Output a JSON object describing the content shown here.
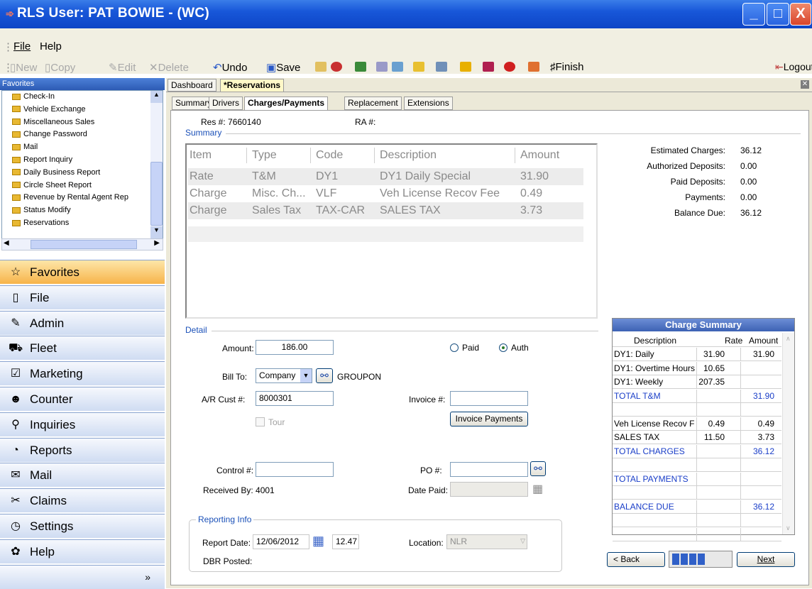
{
  "window": {
    "title": "RLS  User: PAT BOWIE - (WC)",
    "minimize": "_",
    "maximize": "□",
    "close": "X"
  },
  "menu": {
    "file": "File",
    "help": "Help"
  },
  "toolbar": {
    "new": "New",
    "copy": "Copy",
    "edit": "Edit",
    "delete": "Delete",
    "undo": "Undo",
    "save": "Save",
    "finish": "Finish",
    "logout": "Logout"
  },
  "favorites": {
    "header": "Favorites",
    "items": [
      "Check-In",
      "Vehicle Exchange",
      "Miscellaneous Sales",
      "Change Password",
      "Mail",
      "Report Inquiry",
      "Daily Business Report",
      "Circle Sheet Report",
      "Revenue by Rental Agent Rep",
      "Status Modify",
      "Reservations"
    ]
  },
  "nav": {
    "items": [
      {
        "label": "Favorites",
        "icon": "star-icon",
        "glyph": "☆"
      },
      {
        "label": "File",
        "icon": "document-icon",
        "glyph": "▯"
      },
      {
        "label": "Admin",
        "icon": "admin-tools-icon",
        "glyph": "✎"
      },
      {
        "label": "Fleet",
        "icon": "car-icon",
        "glyph": "⛟"
      },
      {
        "label": "Marketing",
        "icon": "checklist-icon",
        "glyph": "☑"
      },
      {
        "label": "Counter",
        "icon": "people-icon",
        "glyph": "☻"
      },
      {
        "label": "Inquiries",
        "icon": "magnifier-icon",
        "glyph": "⚲"
      },
      {
        "label": "Reports",
        "icon": "pie-chart-icon",
        "glyph": "◔"
      },
      {
        "label": "Mail",
        "icon": "envelope-icon",
        "glyph": "✉"
      },
      {
        "label": "Claims",
        "icon": "wrench-icon",
        "glyph": "✂"
      },
      {
        "label": "Settings",
        "icon": "clock-icon",
        "glyph": "◷"
      },
      {
        "label": "Help",
        "icon": "help-icon",
        "glyph": "✿"
      }
    ],
    "more": "»"
  },
  "doc_tabs": {
    "dashboard": "Dashboard",
    "reservations": "*Reservations"
  },
  "sub_tabs": [
    "Summary",
    "Drivers",
    "Charges/Payments",
    "Replacement",
    "Extensions"
  ],
  "res": {
    "res_label": "Res #:",
    "res_no": "7660140",
    "ra_label": "RA #:"
  },
  "summary": {
    "label": "Summary",
    "columns": [
      "Item",
      "Type",
      "Code",
      "Description",
      "Amount"
    ],
    "rows": [
      [
        "Rate",
        "T&M",
        "DY1",
        "DY1 Daily Special",
        "31.90"
      ],
      [
        "Charge",
        "Misc. Ch...",
        "VLF",
        "Veh License Recov Fee",
        "0.49"
      ],
      [
        "Charge",
        "Sales Tax",
        "TAX-CAR",
        "SALES TAX",
        "3.73"
      ]
    ]
  },
  "totals": [
    {
      "label": "Estimated Charges:",
      "value": "36.12"
    },
    {
      "label": "Authorized Deposits:",
      "value": "0.00"
    },
    {
      "label": "Paid Deposits:",
      "value": "0.00"
    },
    {
      "label": "Payments:",
      "value": "0.00"
    },
    {
      "label": "Balance Due:",
      "value": "36.12"
    }
  ],
  "detail": {
    "label": "Detail",
    "amount_label": "Amount:",
    "amount": "186.00",
    "paid_label": "Paid",
    "auth_label": "Auth",
    "billto_label": "Bill To:",
    "billto": "Company",
    "billto_name": "GROUPON",
    "ar_label": "A/R Cust #:",
    "ar_value": "8000301",
    "invoice_label": "Invoice #:",
    "invoice_value": "",
    "invoice_payments": "Invoice Payments",
    "tour_label": "Tour",
    "control_label": "Control #:",
    "control_value": "",
    "po_label": "PO #:",
    "po_value": "",
    "received_label": "Received By: 4001",
    "datepaid_label": "Date Paid:"
  },
  "reporting": {
    "label": "Reporting Info",
    "report_date_label": "Report Date:",
    "report_date": "12/06/2012",
    "report_time": "12.47",
    "location_label": "Location:",
    "location": "NLR",
    "dbr_label": "DBR Posted:"
  },
  "charge_summary": {
    "title": "Charge Summary",
    "columns": [
      "Description",
      "Rate",
      "Amount"
    ],
    "rows": [
      {
        "desc": "DY1: Daily",
        "rate": "31.90",
        "amount": "31.90",
        "blue": false
      },
      {
        "desc": "DY1: Overtime Hours",
        "rate": "10.65",
        "amount": "",
        "blue": false
      },
      {
        "desc": "DY1: Weekly",
        "rate": "207.35",
        "amount": "",
        "blue": false
      },
      {
        "desc": "TOTAL T&M",
        "rate": "",
        "amount": "31.90",
        "blue": true
      },
      {
        "desc": "",
        "rate": "",
        "amount": "",
        "blue": false
      },
      {
        "desc": "Veh License Recov F",
        "rate": "0.49",
        "amount": "0.49",
        "blue": false
      },
      {
        "desc": "SALES TAX",
        "rate": "11.50",
        "amount": "3.73",
        "blue": false
      },
      {
        "desc": "TOTAL CHARGES",
        "rate": "",
        "amount": "36.12",
        "blue": true
      },
      {
        "desc": "",
        "rate": "",
        "amount": "",
        "blue": false
      },
      {
        "desc": "TOTAL PAYMENTS",
        "rate": "",
        "amount": "",
        "blue": true
      },
      {
        "desc": "",
        "rate": "",
        "amount": "",
        "blue": false
      },
      {
        "desc": "BALANCE DUE",
        "rate": "",
        "amount": "36.12",
        "blue": true
      },
      {
        "desc": "",
        "rate": "",
        "amount": "",
        "blue": false
      },
      {
        "desc": "",
        "rate": "",
        "amount": "",
        "blue": false
      }
    ]
  },
  "wizard": {
    "back": "< Back",
    "next": "Next",
    "progress_steps": 4
  }
}
